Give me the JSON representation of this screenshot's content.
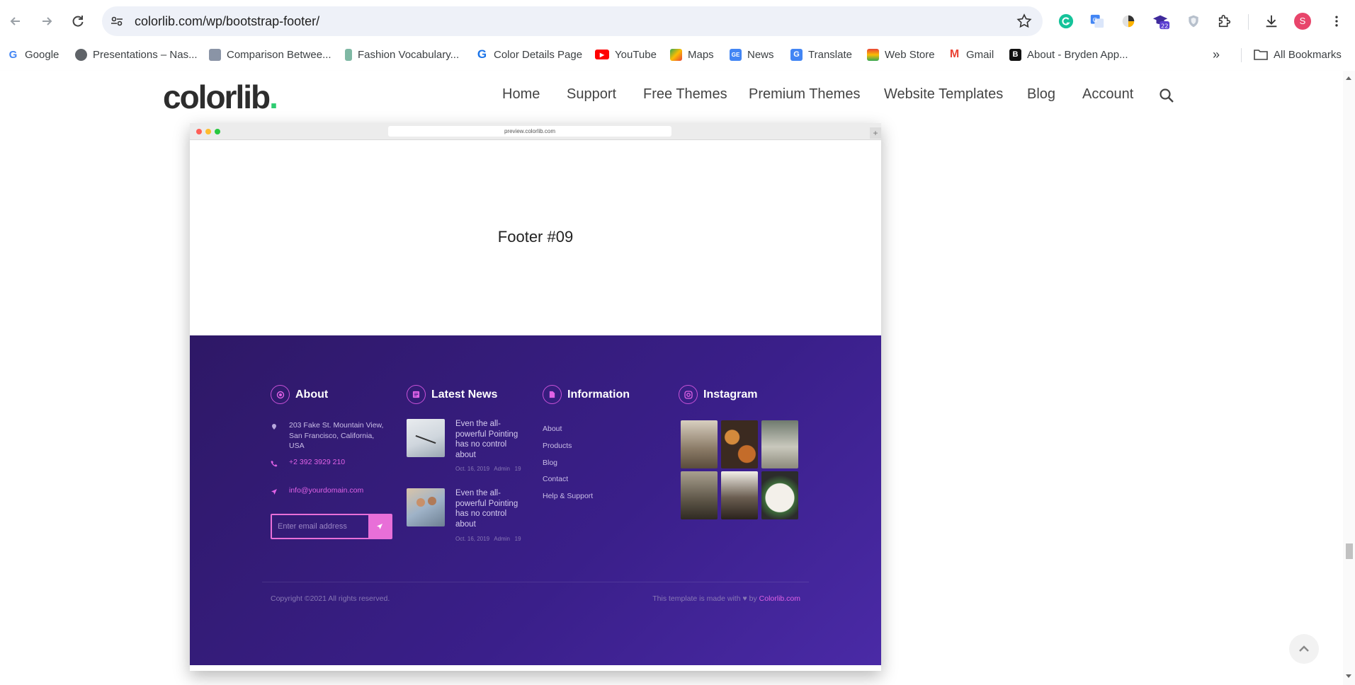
{
  "browser": {
    "url": "colorlib.com/wp/bootstrap-footer/",
    "profile_initial": "S",
    "extension_badge": "22",
    "bookmarks": [
      {
        "label": "Google",
        "icon": "google-icon"
      },
      {
        "label": "Presentations – Nas...",
        "icon": "globe-icon"
      },
      {
        "label": "Comparison Betwee...",
        "icon": "site-icon"
      },
      {
        "label": "Fashion Vocabulary...",
        "icon": "site-icon"
      },
      {
        "label": "Color Details Page",
        "icon": "g-icon"
      },
      {
        "label": "YouTube",
        "icon": "youtube-icon"
      },
      {
        "label": "Maps",
        "icon": "maps-icon"
      },
      {
        "label": "News",
        "icon": "news-icon"
      },
      {
        "label": "Translate",
        "icon": "translate-icon"
      },
      {
        "label": "Web Store",
        "icon": "webstore-icon"
      },
      {
        "label": "Gmail",
        "icon": "gmail-icon"
      },
      {
        "label": "About - Bryden App...",
        "icon": "b-icon"
      }
    ],
    "all_bookmarks": "All Bookmarks"
  },
  "site": {
    "logo": "colorlib",
    "logo_dot": ".",
    "menu": [
      "Home",
      "Support",
      "Free Themes",
      "Premium Themes",
      "Website Templates",
      "Blog",
      "Account"
    ]
  },
  "preview": {
    "url": "preview.colorlib.com",
    "plus": "+",
    "heading": "Footer #09",
    "footer": {
      "about": {
        "title": "About",
        "address": "203 Fake St. Mountain View, San Francisco, California, USA",
        "phone": "+2 392 3929 210",
        "email": "info@yourdomain.com",
        "email_placeholder": "Enter email address"
      },
      "news": {
        "title": "Latest News",
        "items": [
          {
            "text": "Even the all-powerful Pointing has no control about",
            "date": "Oct. 16, 2019",
            "author": "Admin",
            "comments": "19"
          },
          {
            "text": "Even the all-powerful Pointing has no control about",
            "date": "Oct. 16, 2019",
            "author": "Admin",
            "comments": "19"
          }
        ]
      },
      "information": {
        "title": "Information",
        "links": [
          "About",
          "Products",
          "Blog",
          "Contact",
          "Help & Support"
        ]
      },
      "instagram": {
        "title": "Instagram"
      },
      "copyright": "Copyright ©2021 All rights reserved.",
      "made_prefix": "This template is made with",
      "made_by": "by",
      "made_link": "Colorlib.com"
    }
  },
  "colors": {
    "accent_pink": "#e062e6",
    "footer_purple": "#3a1f8a",
    "logo_green": "#2ecc71"
  }
}
